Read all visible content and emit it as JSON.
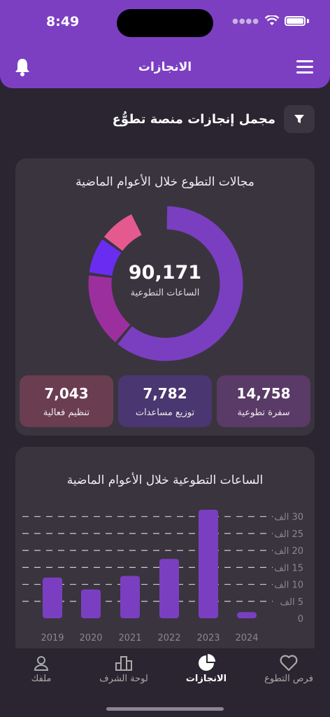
{
  "status": {
    "time": "8:49"
  },
  "header": {
    "title": "الانجازات"
  },
  "section": {
    "title": "مجمل إنجازات منصة تطوُّع"
  },
  "areas_card": {
    "title": "مجالات التطوع خلال الأعوام الماضية",
    "total_value": "90,171",
    "total_label": "الساعات التطوعية",
    "segments": [
      {
        "fraction": 0.61,
        "color": "#7a3fc0"
      },
      {
        "fraction": 0.16,
        "color": "#9c2f9e"
      },
      {
        "fraction": 0.08,
        "color": "#6a2cf0"
      },
      {
        "fraction": 0.08,
        "color": "#e55a8e"
      }
    ],
    "stats": [
      {
        "value": "14,758",
        "label": "سفرة تطوعية",
        "color": "#5a3a66"
      },
      {
        "value": "7,782",
        "label": "توزيع مساعدات",
        "color": "#4a3670"
      },
      {
        "value": "7,043",
        "label": "تنظيم فعالية",
        "color": "#6b3d50"
      }
    ]
  },
  "hours_card": {
    "title": "الساعات التطوعية خلال الأعوام الماضية"
  },
  "chart_data": {
    "type": "bar",
    "title": "الساعات التطوعية خلال الأعوام الماضية",
    "categories": [
      "2019",
      "2020",
      "2021",
      "2022",
      "2023",
      "2024"
    ],
    "values": [
      12000,
      8500,
      12500,
      17500,
      32000,
      1800
    ],
    "y_ticks": [
      "0",
      "5 الف",
      "10 الف",
      "15 الف",
      "20 الف",
      "25 الف",
      "30 الف"
    ],
    "ylim": [
      0,
      32000
    ],
    "grid": true,
    "bar_color": "#7a3fc0"
  },
  "tabs": [
    {
      "label": "فرص التطوع",
      "icon": "heart-icon"
    },
    {
      "label": "الانجازات",
      "icon": "pie-chart-icon",
      "active": true
    },
    {
      "label": "لوحة الشرف",
      "icon": "podium-icon"
    },
    {
      "label": "ملفك",
      "icon": "user-icon"
    }
  ]
}
